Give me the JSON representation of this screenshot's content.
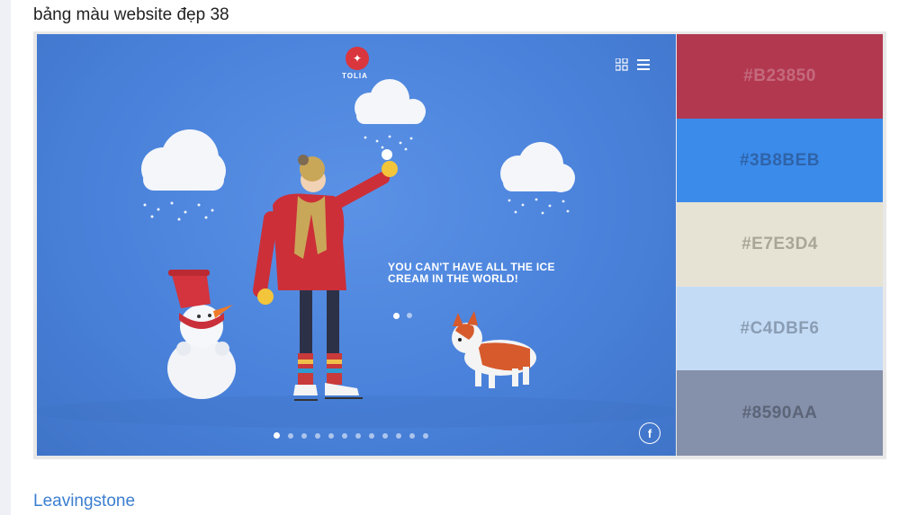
{
  "page": {
    "heading": "bảng màu website đẹp 38",
    "link_text": "Leavingstone"
  },
  "hero": {
    "logo_text": "TOLIA",
    "tagline": "YOU CAN'T HAVE ALL THE ICE CREAM IN THE WORLD!",
    "facebook_icon": "f",
    "slide_count": 12,
    "active_slide_index": 0
  },
  "palette": {
    "swatches": [
      {
        "hex": "#B23850",
        "label": "#B23850",
        "text_color": "#c46a7c"
      },
      {
        "hex": "#3B8BEB",
        "label": "#3B8BEB",
        "text_color": "#2f63a8"
      },
      {
        "hex": "#E7E3D4",
        "label": "#E7E3D4",
        "text_color": "#a9a698"
      },
      {
        "hex": "#C4DBF6",
        "label": "#C4DBF6",
        "text_color": "#8a9db3"
      },
      {
        "hex": "#8590AA",
        "label": "#8590AA",
        "text_color": "#5c6478"
      }
    ]
  },
  "icons": {
    "grid": "grid-icon",
    "menu": "hamburger-menu-icon",
    "facebook": "facebook-icon",
    "logo": "tolia-logo-icon"
  }
}
